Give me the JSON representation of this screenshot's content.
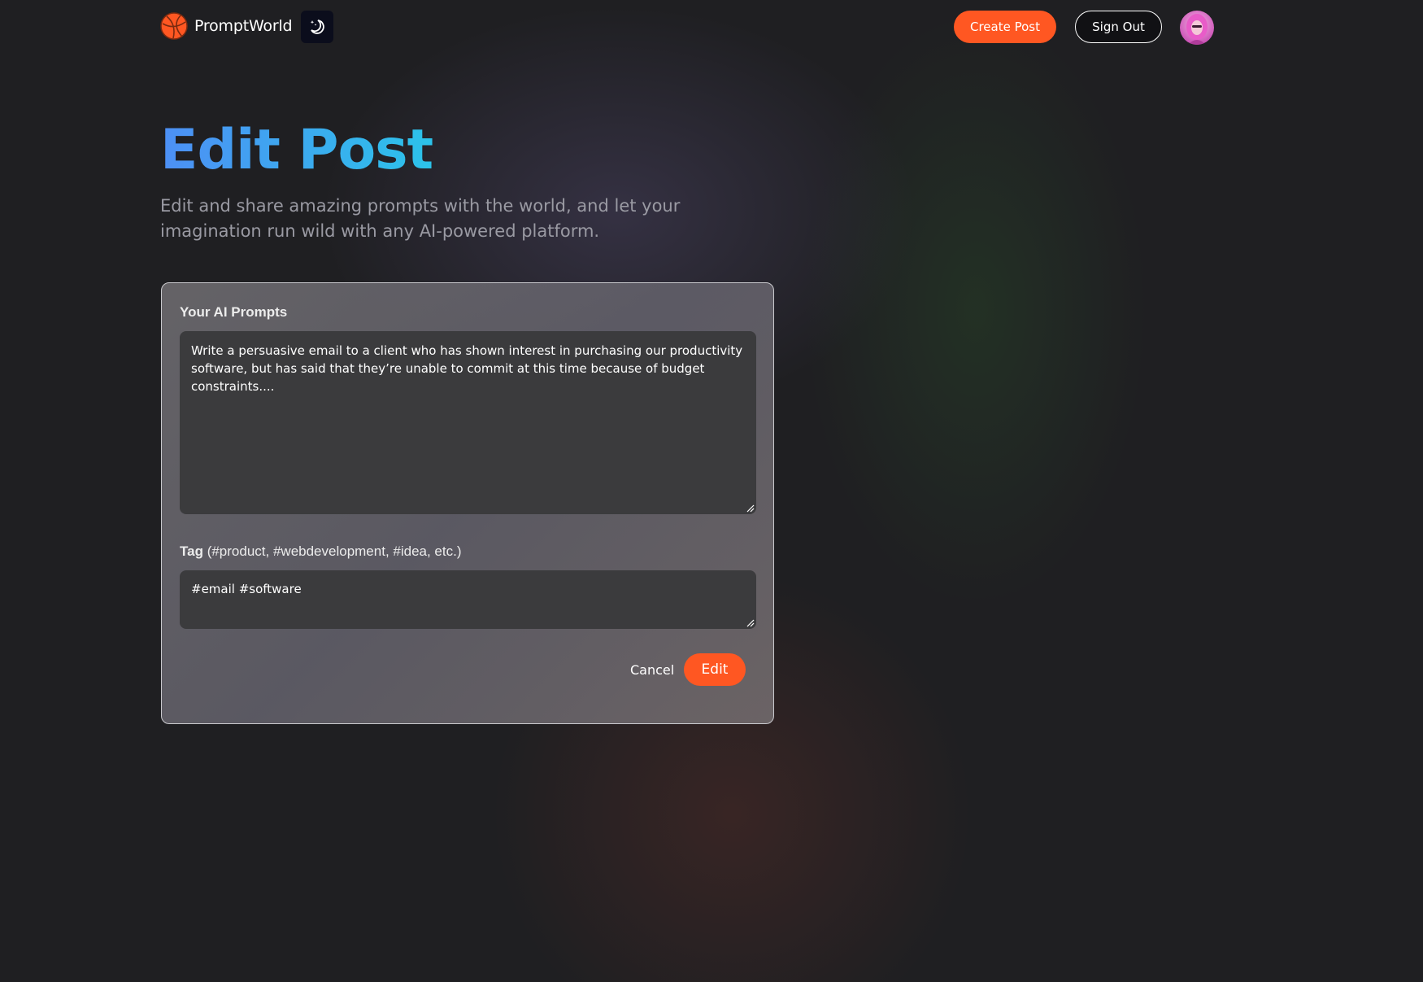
{
  "nav": {
    "brand_name": "PromptWorld",
    "logo_icon": "globe-logo-icon",
    "theme_icon": "moon-stars-icon",
    "create_post_label": "Create Post",
    "sign_out_label": "Sign Out",
    "avatar_icon": "user-avatar"
  },
  "hero": {
    "title": "Edit Post",
    "description": "Edit and share amazing prompts with the world, and let your imagination run wild with any AI-powered platform."
  },
  "form": {
    "prompt_label": "Your AI Prompts",
    "prompt_value": "Write a persuasive email to a client who has shown interest in purchasing our productivity software, but has said that they’re unable to commit at this time because of budget constraints....",
    "tag_label_bold": "Tag",
    "tag_label_hint": " (#product, #webdevelopment, #idea, etc.)",
    "tag_value": "#email #software",
    "cancel_label": "Cancel",
    "submit_label": "Edit"
  },
  "colors": {
    "accent": "#ff5722",
    "title_gradient_start": "#4d8ff5",
    "title_gradient_end": "#2cc3ea",
    "background": "#1f1f22"
  }
}
